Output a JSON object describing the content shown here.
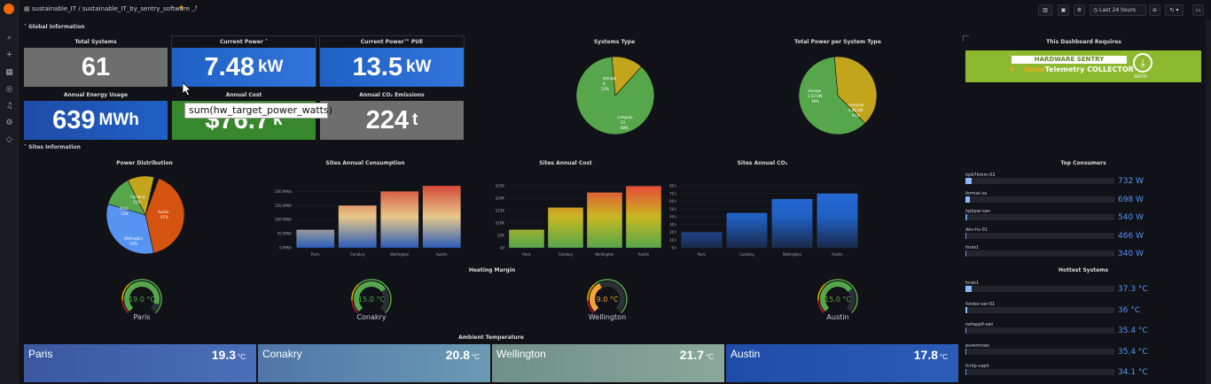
{
  "topbar": {
    "breadcrumb_folder": "sustainable_IT",
    "breadcrumb_sep": "/",
    "breadcrumb_dashboard": "sustainable_IT_by_sentry_software",
    "time_range": "Last 24 hours"
  },
  "sections": {
    "global": "Global Information",
    "sites": "Sites Information"
  },
  "stats": {
    "total_systems": {
      "title": "Total Systems",
      "value": "61",
      "unit": ""
    },
    "current_power": {
      "title": "Current Power",
      "value": "7.48",
      "unit": "kW"
    },
    "current_power_pue": {
      "title": "Current Power™ PUE",
      "value": "13.5",
      "unit": "kW"
    },
    "annual_energy": {
      "title": "Annual Energy Usage",
      "value": "639",
      "unit": "MWh"
    },
    "annual_cost": {
      "title": "Annual Cost",
      "value": "$76.7",
      "unit": "k"
    },
    "annual_co2": {
      "title": "Annual CO₂ Emissions",
      "value": "224",
      "unit": "t"
    }
  },
  "tooltip": "sum(hw_target_power_watts)",
  "systems_type": {
    "title": "Systems Type",
    "slices": [
      {
        "label": "storage",
        "value": 8,
        "pct": "12%",
        "color": "#c3a51c"
      },
      {
        "label": "compute",
        "value": 53,
        "pct": "88%",
        "color": "#56a64b"
      }
    ]
  },
  "power_per_type": {
    "title": "Total Power per System Type",
    "slices": [
      {
        "label": "storage",
        "value": "3.03 kW",
        "pct": "39%",
        "share": 0.39,
        "color": "#c3a51c"
      },
      {
        "label": "compute",
        "value": "4.46 kW",
        "pct": "61%",
        "share": 0.61,
        "color": "#56a64b"
      }
    ]
  },
  "banner": {
    "title": "This Dashboard Requires",
    "line1": "HARDWARE SENTRY",
    "line2a": "Open",
    "line2b": "Telemetry",
    "line2c": "COLLECTOR",
    "brand": "SENTRY"
  },
  "power_distribution": {
    "title": "Power Distribution",
    "slices": [
      {
        "label": "Austin",
        "pct": "41%",
        "share": 0.41,
        "color": "#d4530e"
      },
      {
        "label": "Wellington",
        "pct": "33%",
        "share": 0.33,
        "color": "#5794f2"
      },
      {
        "label": "Paris",
        "pct": "13%",
        "share": 0.13,
        "color": "#56a64b"
      },
      {
        "label": "Conakry",
        "pct": "11%",
        "share": 0.11,
        "color": "#c3a51c"
      }
    ]
  },
  "chart_data": [
    {
      "type": "bar",
      "title": "Sites Annual Consumption",
      "categories": [
        "Paris",
        "Conakry",
        "Wellington",
        "Austin"
      ],
      "values": [
        64,
        150,
        200,
        220
      ],
      "ylim": [
        0,
        220
      ],
      "ticks": [
        "0 MWh",
        "50 MWh",
        "100 MWh",
        "150 MWh",
        "200 MWh"
      ],
      "tickvals": [
        0,
        50,
        100,
        150,
        200
      ]
    },
    {
      "type": "bar",
      "title": "Sites Annual Cost",
      "categories": [
        "Paris",
        "Conakry",
        "Wellington",
        "Austin"
      ],
      "values": [
        5.4,
        12,
        16.5,
        18.4
      ],
      "ylim": [
        0,
        18.5
      ],
      "ticks": [
        "$0",
        "$5K",
        "$10K",
        "$15K",
        "$20K",
        "$25K"
      ],
      "tickvals": [
        0,
        3.7,
        7.4,
        11.1,
        14.8,
        18.5
      ]
    },
    {
      "type": "bar",
      "title": "Sites Annual CO₂",
      "categories": [
        "Paris",
        "Conakry",
        "Wellington",
        "Austin"
      ],
      "values": [
        20,
        45,
        63,
        70
      ],
      "ylim": [
        0,
        80
      ],
      "ticks": [
        "0 t",
        "10 t",
        "20 t",
        "30 t",
        "40 t",
        "50 t",
        "60 t",
        "70 t",
        "80 t"
      ],
      "tickvals": [
        0,
        10,
        20,
        30,
        40,
        50,
        60,
        70,
        80
      ]
    }
  ],
  "heating": {
    "title": "Heating Margin",
    "gauges": [
      {
        "site": "Paris",
        "value": "19.0",
        "unit": "°C",
        "level": 0.9
      },
      {
        "site": "Conakry",
        "value": "15.0",
        "unit": "°C",
        "level": 0.7
      },
      {
        "site": "Wellington",
        "value": "9.0",
        "unit": "°C",
        "level": 0.4
      },
      {
        "site": "Austin",
        "value": "15.0",
        "unit": "°C",
        "level": 0.7
      }
    ]
  },
  "ambient": {
    "title": "Ambient Temperature",
    "sites": [
      {
        "name": "Paris",
        "value": "19.3",
        "unit": "°C"
      },
      {
        "name": "Conakry",
        "value": "20.8",
        "unit": "°C"
      },
      {
        "name": "Wellington",
        "value": "21.7",
        "unit": "°C"
      },
      {
        "name": "Austin",
        "value": "17.8",
        "unit": "°C"
      }
    ]
  },
  "top_consumers": {
    "title": "Top Consumers",
    "items": [
      {
        "label": "hpb7kmm-02",
        "value": "732 W",
        "fraction": 0.04
      },
      {
        "label": "fermat-os",
        "value": "698 W",
        "fraction": 0.03
      },
      {
        "label": "hpbpar-san",
        "value": "540 W",
        "fraction": 0.01
      },
      {
        "label": "dev-hv-01",
        "value": "466 W",
        "fraction": 0
      },
      {
        "label": "hnas1",
        "value": "340 W",
        "fraction": 0
      }
    ]
  },
  "hottest": {
    "title": "Hottest Systems",
    "items": [
      {
        "label": "hnas1",
        "value": "37.3 °C",
        "fraction": 0.04
      },
      {
        "label": "fordev-sar-01",
        "value": "36 °C",
        "fraction": 0.01
      },
      {
        "label": "netapp9-san",
        "value": "35.4 °C",
        "fraction": 0
      },
      {
        "label": "puremrsan",
        "value": "35.4 °C",
        "fraction": 0
      },
      {
        "label": "fcrhp-caph",
        "value": "34.1 °C",
        "fraction": 0
      }
    ]
  }
}
